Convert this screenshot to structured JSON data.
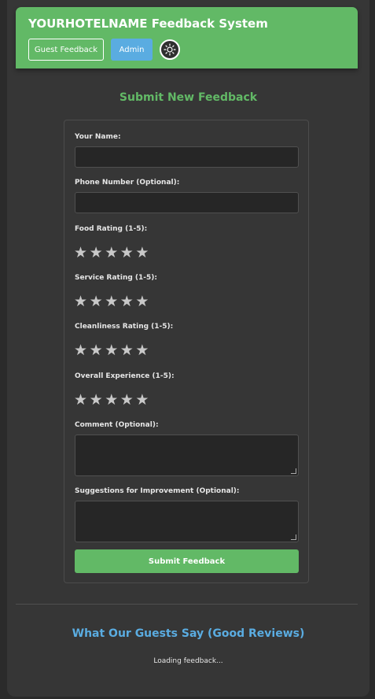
{
  "header": {
    "title": "YOURHOTELNAME Feedback System",
    "nav": {
      "guest_label": "Guest Feedback",
      "admin_label": "Admin"
    },
    "theme_toggle_icon": "sun-icon"
  },
  "form": {
    "title": "Submit New Feedback",
    "name_label": "Your Name:",
    "name_value": "",
    "phone_label": "Phone Number (Optional):",
    "phone_value": "",
    "ratings": [
      {
        "label": "Food Rating (1-5):",
        "value": 0,
        "max": 5
      },
      {
        "label": "Service Rating (1-5):",
        "value": 0,
        "max": 5
      },
      {
        "label": "Cleanliness Rating (1-5):",
        "value": 0,
        "max": 5
      },
      {
        "label": "Overall Experience (1-5):",
        "value": 0,
        "max": 5
      }
    ],
    "star_glyph": "★",
    "comment_label": "Comment (Optional):",
    "comment_value": "",
    "suggestions_label": "Suggestions for Improvement (Optional):",
    "suggestions_value": "",
    "submit_label": "Submit Feedback"
  },
  "reviews": {
    "title": "What Our Guests Say (Good Reviews)",
    "status": "Loading feedback..."
  },
  "colors": {
    "primary_green": "#62b966",
    "accent_blue": "#5aace1",
    "background": "#363636",
    "input_background": "#262626",
    "star_empty": "#c8c8c8"
  }
}
